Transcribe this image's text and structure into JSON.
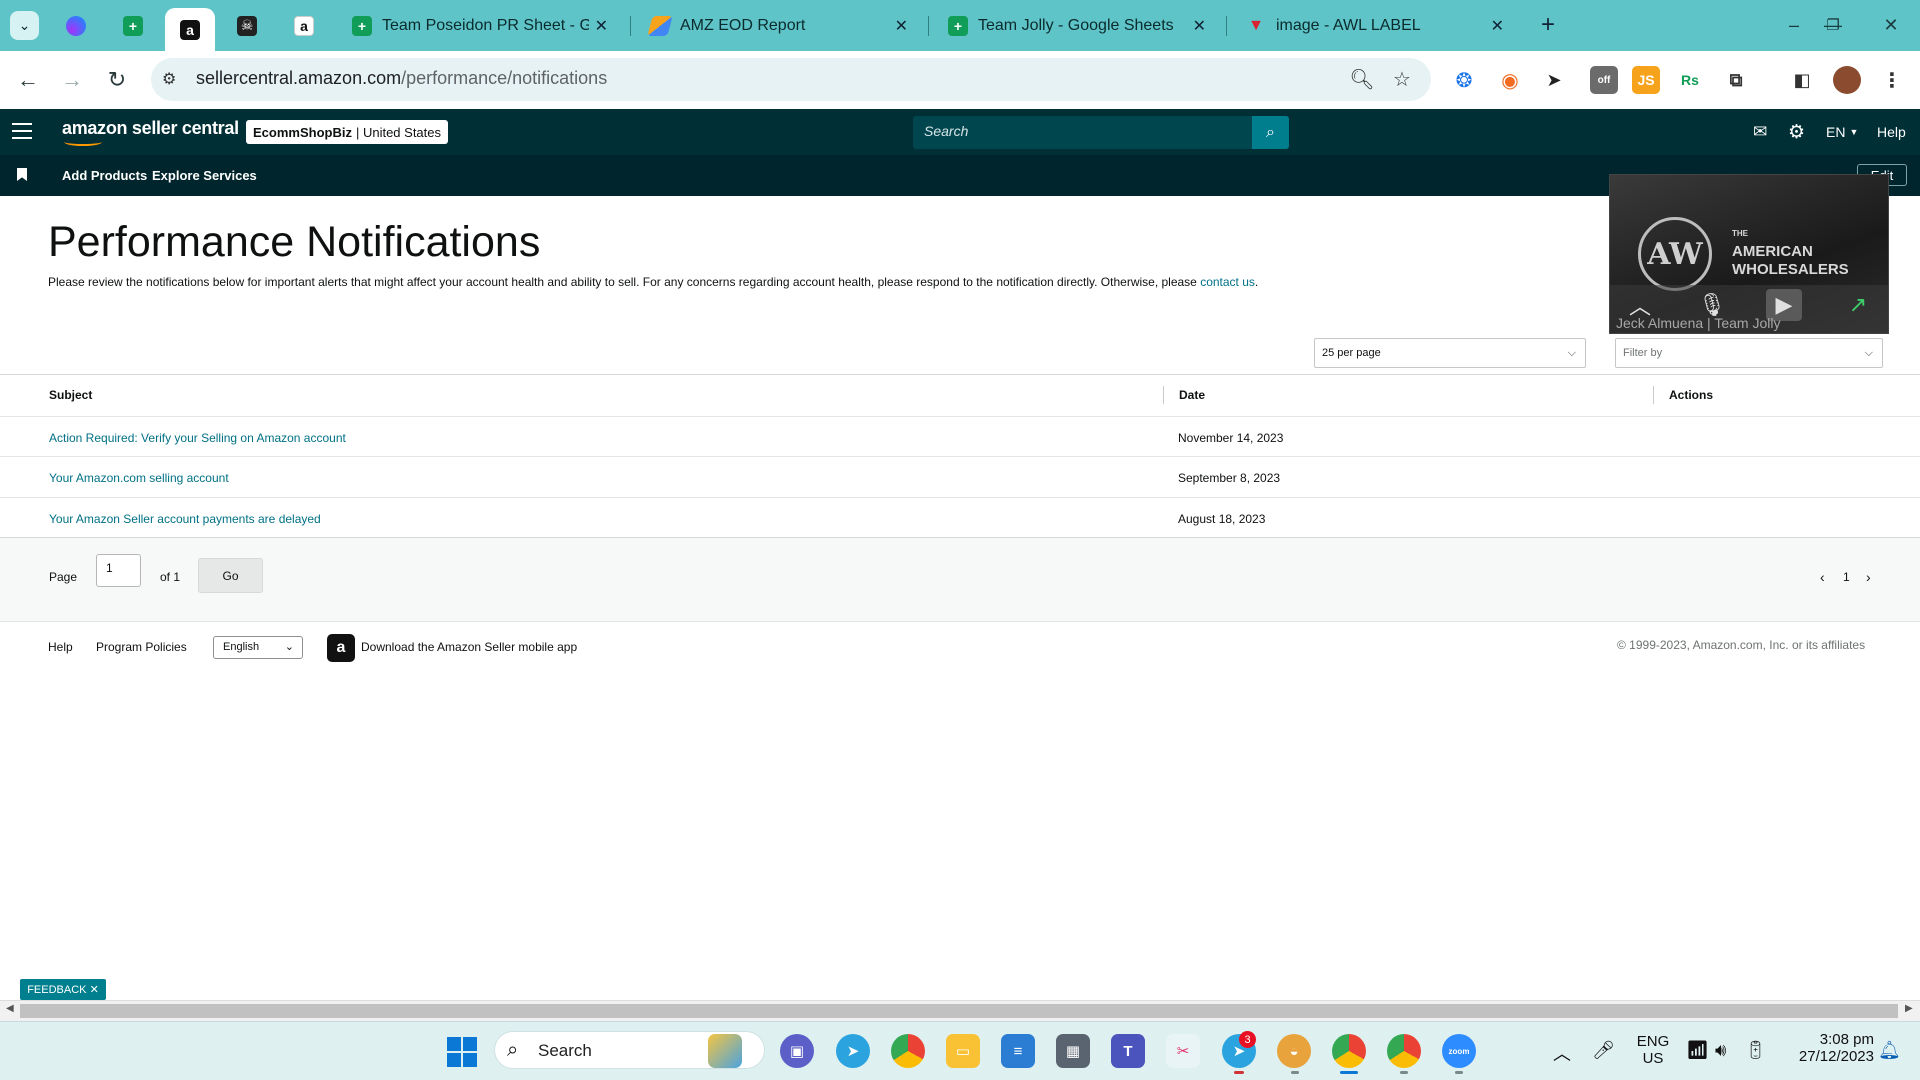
{
  "browser": {
    "tabs": [
      {
        "title": "Team Poseidon PR Sheet - Goo"
      },
      {
        "title": "AMZ EOD Report"
      },
      {
        "title": "Team Jolly - Google Sheets"
      },
      {
        "title": "image - AWL LABEL"
      }
    ],
    "url_host": "sellercentral.amazon.com",
    "url_path": "/performance/notifications"
  },
  "header": {
    "logo": "amazon seller central",
    "store_name": "EcommShopBiz",
    "store_region": "| United States",
    "search_placeholder": "Search",
    "language": "EN",
    "help": "Help"
  },
  "subnav": {
    "add_products": "Add Products",
    "explore_services": "Explore Services",
    "edit": "Edit"
  },
  "page": {
    "title": "Performance Notifications",
    "intro": "Please review the notifications below for important alerts that might affect your account health and ability to sell. For any concerns regarding account health, please respond to the notification directly. Otherwise, please",
    "contact_link": "contact us",
    "per_page": "25 per page",
    "filter_placeholder": "Filter by"
  },
  "table": {
    "columns": {
      "subject": "Subject",
      "date": "Date",
      "actions": "Actions"
    },
    "rows": [
      {
        "subject": "Action Required: Verify your Selling on Amazon account",
        "date": "November 14, 2023"
      },
      {
        "subject": "Your Amazon.com selling account",
        "date": "September 8, 2023"
      },
      {
        "subject": "Your Amazon Seller account payments are delayed",
        "date": "August 18, 2023"
      }
    ]
  },
  "pager": {
    "page_label": "Page",
    "page_value": "1",
    "of_label": "of 1",
    "go": "Go",
    "current": "1"
  },
  "footer": {
    "help": "Help",
    "program_policies": "Program Policies",
    "language": "English",
    "mobile_app": "Download the Amazon Seller mobile app",
    "copyright": "© 1999-2023, Amazon.com, Inc. or its affiliates"
  },
  "feedback": "FEEDBACK",
  "video_overlay": {
    "brand_small": "THE",
    "brand_line1": "AMERICAN",
    "brand_line2": "WHOLESALERS",
    "participants": "Jeck Almuena | Team Jolly"
  },
  "taskbar": {
    "search": "Search",
    "telegram_badge": "3",
    "lang_line1": "ENG",
    "lang_line2": "US",
    "time": "3:08 pm",
    "date": "27/12/2023"
  }
}
